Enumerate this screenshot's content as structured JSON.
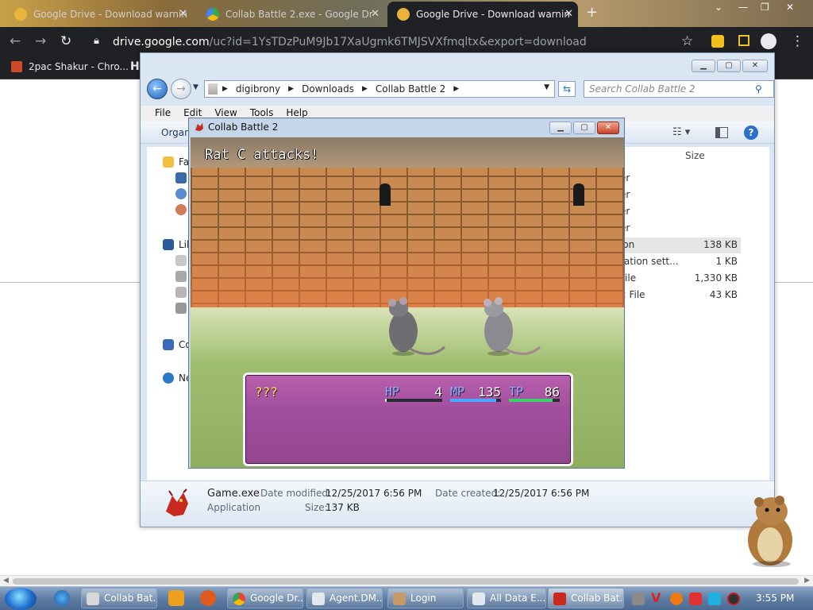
{
  "browser": {
    "tabs": [
      {
        "title": "Google Drive - Download warnin",
        "active": false
      },
      {
        "title": "Collab Battle 2.exe - Google Dr",
        "active": false
      },
      {
        "title": "Google Drive - Download warnin",
        "active": true
      }
    ],
    "url_host": "drive.google.com",
    "url_path": "/uc?id=1YsTDzPuM9Jb17XaUgmk6TMJSVXfmqltx&export=download",
    "bookmarks": [
      {
        "label": "2pac Shakur - Chro..."
      },
      {
        "label": "H"
      }
    ]
  },
  "explorer": {
    "breadcrumbs": [
      "digibrony",
      "Downloads",
      "Collab Battle 2"
    ],
    "search_placeholder": "Search Collab Battle 2",
    "menu": [
      "File",
      "Edit",
      "View",
      "Tools",
      "Help"
    ],
    "command_organize": "Organi",
    "nav_items": [
      "Fa",
      "Lib",
      "Co",
      "Ne"
    ],
    "size_header": "Size",
    "files": [
      {
        "type": "er",
        "size": ""
      },
      {
        "type": "er",
        "size": ""
      },
      {
        "type": "er",
        "size": ""
      },
      {
        "type": "er",
        "size": ""
      },
      {
        "type": "ion",
        "size": "138 KB",
        "selected": true
      },
      {
        "type": "ration sett...",
        "size": "1 KB"
      },
      {
        "type": "File",
        "size": "1,330 KB"
      },
      {
        "type": "2 File",
        "size": "43 KB"
      }
    ],
    "details": {
      "name": "Game.exe",
      "kind": "Application",
      "modified_label": "Date modified:",
      "modified_value": "12/25/2017 6:56 PM",
      "created_label": "Date created:",
      "created_value": "12/25/2017 6:56 PM",
      "size_label": "Size:",
      "size_value": "137 KB"
    }
  },
  "game": {
    "window_title": "Collab Battle 2",
    "battle_message": "Rat C attacks!",
    "actor_name": "???",
    "hp_label": "HP",
    "hp_value": "4",
    "mp_label": "MP",
    "mp_value": "135",
    "tp_label": "TP",
    "tp_value": "86",
    "hp_fill": 0.03,
    "mp_fill": 0.9,
    "tp_fill": 0.86
  },
  "taskbar": {
    "items": [
      {
        "label": "Collab Bat...",
        "active": false
      },
      {
        "label": "Google Dr...",
        "active": false
      },
      {
        "label": "Agent.DM...",
        "active": false
      },
      {
        "label": "Login",
        "active": false
      },
      {
        "label": "All Data E...",
        "active": false
      },
      {
        "label": "Collab Bat...",
        "active": true
      }
    ],
    "clock": "3:55 PM"
  },
  "colors": {
    "chrome_dark": "#202124",
    "status_window": "#a04f9c",
    "hp_gauge": "#e0e0e0",
    "mp_gauge": "#4aa8ff",
    "tp_gauge": "#3ad06a"
  }
}
